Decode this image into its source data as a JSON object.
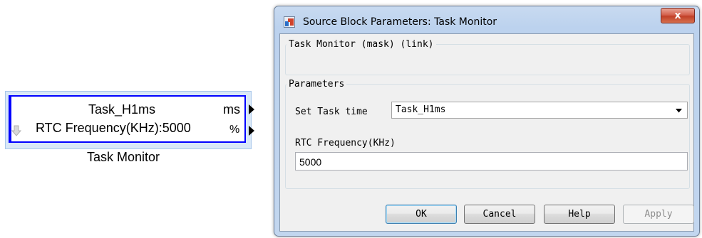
{
  "block": {
    "line1": "Task_H1ms",
    "line2": "RTC Frequency(KHz):5000",
    "port_out1": "ms",
    "port_out2": "%",
    "caption": "Task Monitor",
    "selection_color": "#d9e8f7",
    "border_color": "#0000ff"
  },
  "dialog": {
    "title": "Source Block Parameters: Task Monitor",
    "close_label": "x",
    "mask_group": "Task Monitor (mask) (link)",
    "params_group": "Parameters",
    "task_time_label": "Set Task time",
    "task_time_value": "Task_H1ms",
    "rtc_label": "RTC Frequency(KHz)",
    "rtc_value": "5000",
    "buttons": {
      "ok": "OK",
      "cancel": "Cancel",
      "help": "Help",
      "apply": "Apply"
    }
  }
}
